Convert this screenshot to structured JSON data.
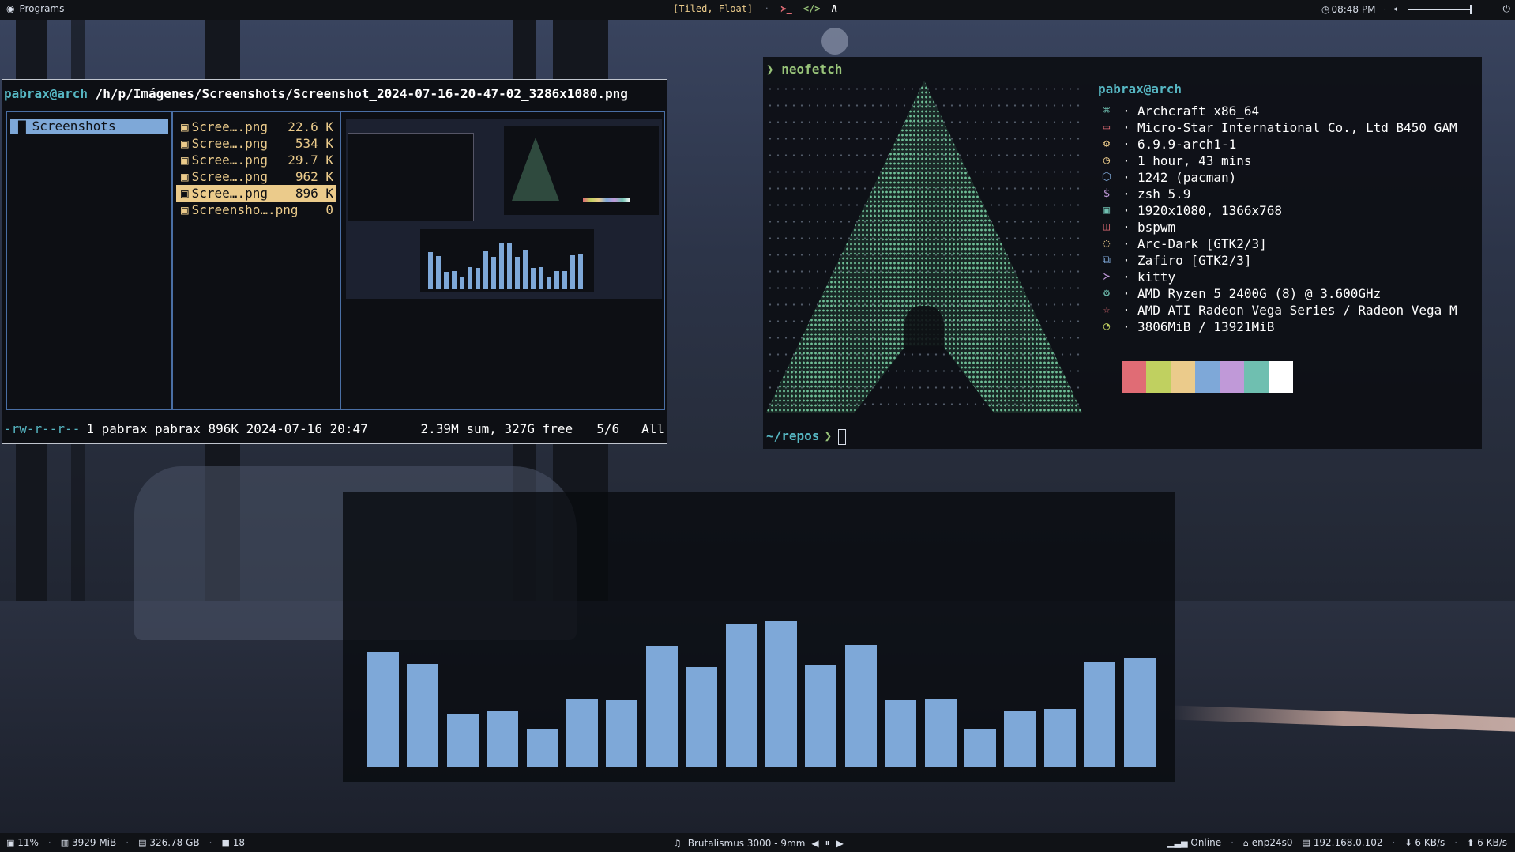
{
  "topbar": {
    "programs_label": "Programs",
    "layout_label": "[Tiled, Float]",
    "separator": "·",
    "time": "08:48 PM"
  },
  "ranger": {
    "host": "pabrax@arch",
    "path": "/h/p/Imágenes/Screenshots/Screenshot_2024-07-16-20-47-02_3286x1080.png",
    "parent_dir": "Screenshots",
    "files": [
      {
        "name": "Scree….png",
        "size": "22.6 K"
      },
      {
        "name": "Scree….png",
        "size": "534 K"
      },
      {
        "name": "Scree….png",
        "size": "29.7 K"
      },
      {
        "name": "Scree….png",
        "size": "962 K"
      },
      {
        "name": "Scree….png",
        "size": "896 K"
      },
      {
        "name": "Screensho….png",
        "size": "0"
      }
    ],
    "status": {
      "perm": "-rw-r--r--",
      "info": "1 pabrax pabrax 896K 2024-07-16 20:47",
      "sum": "2.39M sum, 327G free",
      "pos": "5/6",
      "all": "All"
    }
  },
  "neofetch": {
    "command": "❯ neofetch",
    "userhost": "pabrax@arch",
    "rows": [
      {
        "icon": "⌘",
        "color": "#6fbfb0",
        "text": "Archcraft x86_64"
      },
      {
        "icon": "▭",
        "color": "#e06c75",
        "text": "Micro-Star International Co., Ltd B450 GAM"
      },
      {
        "icon": "⚙",
        "color": "#ebcb8b",
        "text": "6.9.9-arch1-1"
      },
      {
        "icon": "◷",
        "color": "#ebcb8b",
        "text": "1 hour, 43 mins"
      },
      {
        "icon": "⬡",
        "color": "#7ea8d8",
        "text": "1242 (pacman)"
      },
      {
        "icon": "$",
        "color": "#c099d8",
        "text": "zsh 5.9"
      },
      {
        "icon": "▣",
        "color": "#6fbfb0",
        "text": "1920x1080, 1366x768"
      },
      {
        "icon": "◫",
        "color": "#e06c75",
        "text": "bspwm"
      },
      {
        "icon": "◌",
        "color": "#ebcb8b",
        "text": "Arc-Dark [GTK2/3]"
      },
      {
        "icon": "⧉",
        "color": "#7ea8d8",
        "text": "Zafiro [GTK2/3]"
      },
      {
        "icon": "≻",
        "color": "#c099d8",
        "text": "kitty"
      },
      {
        "icon": "⚙",
        "color": "#6fbfb0",
        "text": "AMD Ryzen 5 2400G (8) @ 3.600GHz"
      },
      {
        "icon": "☆",
        "color": "#e06c75",
        "text": "AMD ATI Radeon Vega Series / Radeon Vega M"
      },
      {
        "icon": "◔",
        "color": "#c0d060",
        "text": "3806MiB / 13921MiB"
      }
    ],
    "row_separator": "·",
    "palette": [
      "#e06c75",
      "#c0d060",
      "#ebcb8b",
      "#7ea8d8",
      "#c099d8",
      "#6fbfb0",
      "#ffffff"
    ],
    "prompt_dir": "~/repos",
    "prompt_arrow": "❯"
  },
  "visualizer": {
    "levels": [
      0.78,
      0.7,
      0.36,
      0.38,
      0.26,
      0.46,
      0.45,
      0.82,
      0.68,
      0.97,
      0.99,
      0.69,
      0.83,
      0.45,
      0.46,
      0.26,
      0.38,
      0.39,
      0.71,
      0.74
    ],
    "color": "#7ea8d8"
  },
  "bottombar": {
    "cpu": "11%",
    "ram": "3929 MiB",
    "disk": "326.78 GB",
    "updates": "18",
    "song": "Brutalismus 3000 - 9mm",
    "net_status": "Online",
    "iface": "enp24s0",
    "ip": "192.168.0.102",
    "down": "6 KB/s",
    "up": "6 KB/s"
  }
}
